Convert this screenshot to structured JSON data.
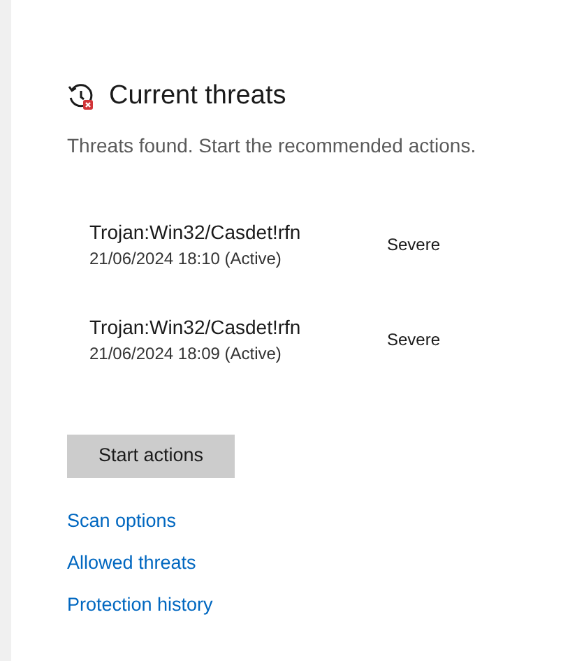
{
  "section": {
    "title": "Current threats",
    "description": "Threats found. Start the recommended actions."
  },
  "threats": [
    {
      "name": "Trojan:Win32/Casdet!rfn",
      "detail": "21/06/2024 18:10 (Active)",
      "severity": "Severe"
    },
    {
      "name": "Trojan:Win32/Casdet!rfn",
      "detail": "21/06/2024 18:09 (Active)",
      "severity": "Severe"
    }
  ],
  "action_button": "Start actions",
  "links": [
    "Scan options",
    "Allowed threats",
    "Protection history"
  ]
}
